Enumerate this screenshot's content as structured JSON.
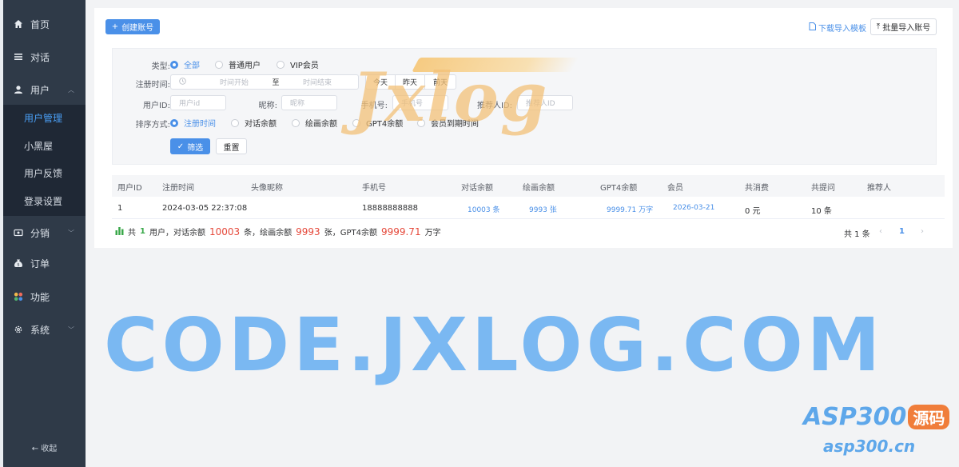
{
  "sidebar": {
    "items": [
      {
        "label": "首页",
        "icon": "home-icon"
      },
      {
        "label": "对话",
        "icon": "menu-lines-icon"
      },
      {
        "label": "用户",
        "icon": "user-icon"
      },
      {
        "label": "分销",
        "icon": "distribution-icon"
      },
      {
        "label": "订单",
        "icon": "money-bag-icon"
      },
      {
        "label": "功能",
        "icon": "grid-dots-icon"
      },
      {
        "label": "系统",
        "icon": "gear-icon"
      }
    ],
    "user_submenu": [
      "用户管理",
      "小黑屋",
      "用户反馈",
      "登录设置"
    ],
    "collapse_label": "收起"
  },
  "toolbar": {
    "create_label": "创建账号",
    "download_label": "下载导入模板",
    "batch_import_label": "批量导入账号"
  },
  "filter": {
    "type_label": "类型:",
    "type_options": [
      "全部",
      "普通用户",
      "VIP会员"
    ],
    "reg_time_label": "注册时间:",
    "start_placeholder": "时间开始",
    "range_sep": "至",
    "end_placeholder": "时间结束",
    "quick_dates": [
      "今天",
      "昨天",
      "前天"
    ],
    "user_id_label": "用户ID:",
    "user_id_placeholder": "用户id",
    "nickname_label": "昵称:",
    "nickname_placeholder": "昵称",
    "phone_label": "手机号:",
    "phone_placeholder": "手机号",
    "referrer_label": "推荐人ID:",
    "referrer_placeholder": "推荐人ID",
    "sort_label": "排序方式:",
    "sort_options": [
      "注册时间",
      "对话余额",
      "绘画余额",
      "GPT4余额",
      "会员到期时间"
    ],
    "filter_button": "筛选",
    "reset_button": "重置"
  },
  "table": {
    "columns": [
      "用户ID",
      "注册时间",
      "头像昵称",
      "手机号",
      "对话余额",
      "绘画余额",
      "GPT4余额",
      "会员",
      "共消费",
      "共提问",
      "推荐人"
    ],
    "rows": [
      {
        "id": "1",
        "reg_time": "2024-03-05 22:37:08",
        "nickname": "",
        "phone": "18888888888",
        "chat_balance": "10003 条",
        "draw_balance": "9993 张",
        "gpt4_balance": "9999.71 万字",
        "vip": "2026-03-21",
        "spent": "0 元",
        "questions": "10 条",
        "referrer": ""
      }
    ]
  },
  "summary": {
    "prefix": "共",
    "user_count": "1",
    "t1": "用户，对话余额",
    "chat_total": "10003",
    "t2": "条，绘画余额",
    "draw_total": "9993",
    "t3": "张，GPT4余额",
    "gpt4_total": "9999.71",
    "t4": "万字"
  },
  "pagination": {
    "total_text": "共 1 条",
    "current_page": "1"
  },
  "watermarks": {
    "logo_text": "Jxlog",
    "center_text": "CODE.JXLOG.COM",
    "corner_brand": "ASP300",
    "corner_badge": "源码",
    "corner_url": "asp300.cn"
  },
  "colors": {
    "sidebar_bg": "#2f3a48",
    "submenu_bg": "#1f2835",
    "accent": "#4a90e8",
    "danger": "#e5483a",
    "success": "#3aa84a"
  }
}
